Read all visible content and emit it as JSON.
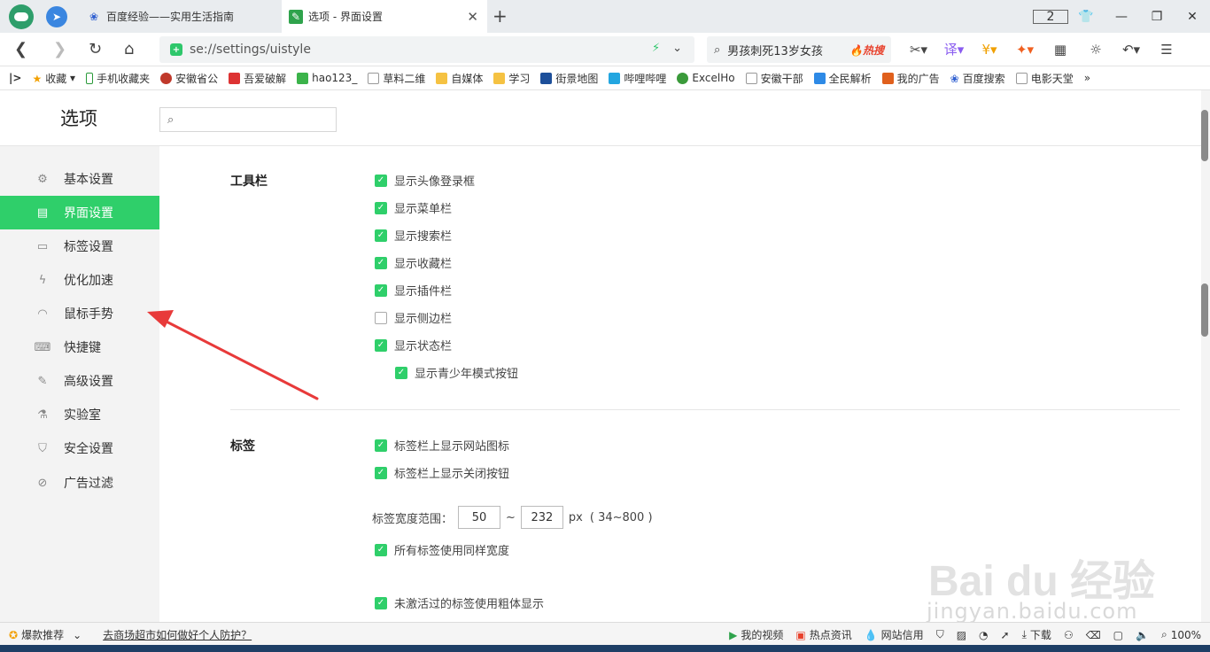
{
  "tabs": [
    {
      "title": "百度经验——实用生活指南",
      "icon": "baidu-paw-icon"
    },
    {
      "title": "选项 - 界面设置",
      "icon": "settings-wrench-icon"
    }
  ],
  "window": {
    "tab_count": "2"
  },
  "address": {
    "url": "se://settings/uistyle"
  },
  "search": {
    "query": "男孩刺死13岁女孩",
    "hot_label": "热搜"
  },
  "bookmarks": {
    "toggle": "|>",
    "items": [
      "收藏",
      "手机收藏夹",
      "安徽省公",
      "吾爱破解",
      "hao123_",
      "草料二维",
      "自媒体",
      "学习",
      "街景地图",
      "哔哩哔哩",
      "ExcelHo",
      "安徽干部",
      "全民解析",
      "我的广告",
      "百度搜索",
      "电影天堂"
    ],
    "more": "»"
  },
  "page": {
    "title": "选项",
    "search_placeholder": ""
  },
  "sidebar": {
    "items": [
      {
        "label": "基本设置",
        "icon": "gear-icon"
      },
      {
        "label": "界面设置",
        "icon": "window-icon"
      },
      {
        "label": "标签设置",
        "icon": "tab-icon"
      },
      {
        "label": "优化加速",
        "icon": "lightning-icon"
      },
      {
        "label": "鼠标手势",
        "icon": "mouse-icon"
      },
      {
        "label": "快捷键",
        "icon": "keyboard-icon"
      },
      {
        "label": "高级设置",
        "icon": "wrench-icon"
      },
      {
        "label": "实验室",
        "icon": "flask-icon"
      },
      {
        "label": "安全设置",
        "icon": "shield-icon"
      },
      {
        "label": "广告过滤",
        "icon": "block-icon"
      }
    ],
    "active_index": 1
  },
  "toolbar_section": {
    "title": "工具栏",
    "options": [
      {
        "label": "显示头像登录框",
        "checked": true
      },
      {
        "label": "显示菜单栏",
        "checked": true
      },
      {
        "label": "显示搜索栏",
        "checked": true
      },
      {
        "label": "显示收藏栏",
        "checked": true
      },
      {
        "label": "显示插件栏",
        "checked": true
      },
      {
        "label": "显示侧边栏",
        "checked": false
      },
      {
        "label": "显示状态栏",
        "checked": true
      },
      {
        "label": "显示青少年模式按钮",
        "checked": true
      }
    ]
  },
  "tabs_section": {
    "title": "标签",
    "options": [
      {
        "label": "标签栏上显示网站图标",
        "checked": true
      },
      {
        "label": "标签栏上显示关闭按钮",
        "checked": true
      }
    ],
    "width_range": {
      "label": "标签宽度范围：",
      "min": "50",
      "separator": "~",
      "max": "232",
      "unit": "px",
      "hint": "( 34~800 )"
    },
    "same_width": {
      "label": "所有标签使用同样宽度",
      "checked": true
    },
    "bold_inactive": {
      "label": "未激活过的标签使用粗体显示",
      "checked": true
    }
  },
  "statusbar": {
    "promo": "爆款推荐",
    "news": "去商场超市如何做好个人防护？",
    "my_video": "我的视频",
    "hot_news": "热点资讯",
    "site_credit": "网站信用",
    "download": "下载",
    "zoom": "100%"
  },
  "watermark": {
    "text": "jingyan.baidu.com"
  },
  "colors": {
    "accent": "#2fcf6a",
    "arrow": "#e83a3a",
    "hot": "#e8412c"
  }
}
